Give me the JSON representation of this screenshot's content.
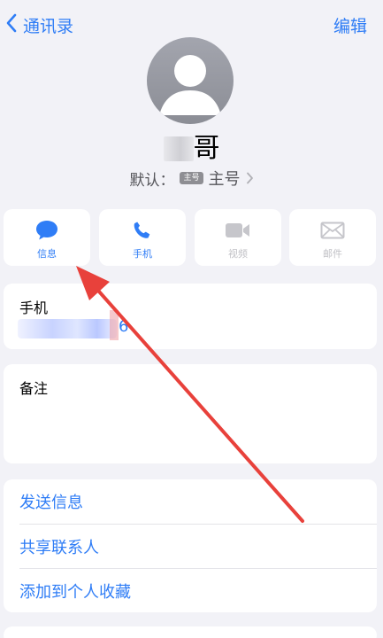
{
  "nav": {
    "back_label": "通讯录",
    "edit_label": "编辑"
  },
  "contact": {
    "name_suffix": "哥",
    "default_label": "默认：",
    "default_badge": "主号",
    "default_value": "主号"
  },
  "actions": [
    {
      "label": "信息",
      "icon": "message-bubble-icon",
      "enabled": true
    },
    {
      "label": "手机",
      "icon": "phone-icon",
      "enabled": true
    },
    {
      "label": "视频",
      "icon": "video-camera-icon",
      "enabled": false
    },
    {
      "label": "邮件",
      "icon": "mail-icon",
      "enabled": false
    }
  ],
  "phone_card": {
    "label": "手机",
    "visible_digit": "6"
  },
  "notes_card": {
    "label": "备注"
  },
  "links": [
    "发送信息",
    "共享联系人",
    "添加到个人收藏"
  ],
  "colors": {
    "accent": "#2f7df6",
    "background": "#f2f2f7",
    "annotation_arrow": "#e8413b"
  }
}
